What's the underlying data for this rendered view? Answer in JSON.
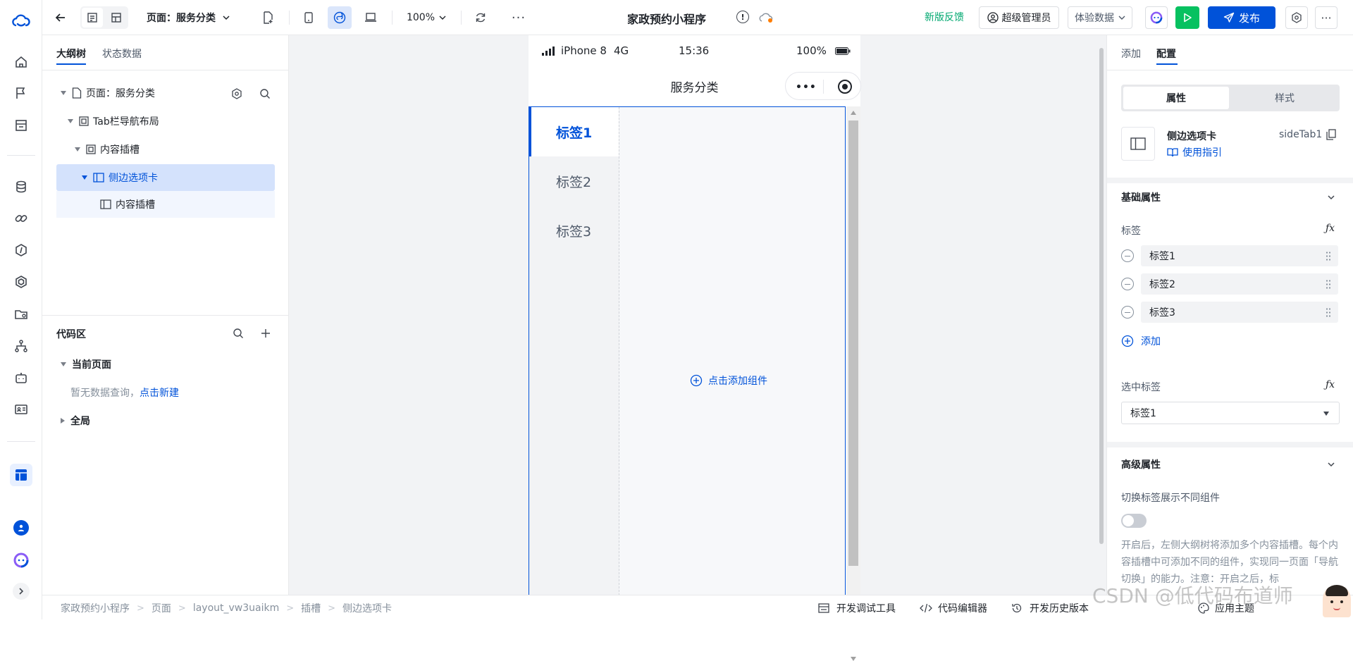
{
  "topbar": {
    "page_selector": "页面：服务分类",
    "zoom": "100%",
    "app_title": "家政预约小程序",
    "feedback": "新版反馈",
    "admin": "超级管理员",
    "data_env": "体验数据",
    "publish": "发布"
  },
  "left": {
    "tabs": [
      "大纲树",
      "状态数据"
    ],
    "tree": [
      {
        "label": "页面：服务分类"
      },
      {
        "label": "Tab栏导航布局"
      },
      {
        "label": "内容插槽"
      },
      {
        "label": "侧边选项卡"
      },
      {
        "label": "内容插槽"
      }
    ],
    "code_title": "代码区",
    "current_page": "当前页面",
    "empty_text": "暂无数据查询，",
    "new_link": "点击新建",
    "global": "全局"
  },
  "phone": {
    "carrier": "iPhone 8",
    "network": "4G",
    "time": "15:36",
    "battery": "100%",
    "page_title": "服务分类",
    "tabs": [
      "标签1",
      "标签2",
      "标签3"
    ],
    "add_component": "点击添加组件"
  },
  "right": {
    "tabs": [
      "添加",
      "配置"
    ],
    "segment": [
      "属性",
      "样式"
    ],
    "component_name": "侧边选项卡",
    "component_id": "sideTab1",
    "guide": "使用指引",
    "basic_title": "基础属性",
    "tags_label": "标签",
    "tag_items": [
      "标签1",
      "标签2",
      "标签3"
    ],
    "add_label": "添加",
    "selected_label": "选中标签",
    "selected_value": "标签1",
    "advanced_title": "高级属性",
    "switch_label": "切换标签展示不同组件",
    "description": "开启后，左侧大纲树将添加多个内容插槽。每个内容插槽中可添加不同的组件，实现同一页面「导航切换」的能力。注意：开启之后，标"
  },
  "bottom": {
    "breadcrumb": [
      "家政预约小程序",
      "页面",
      "layout_vw3uaikm",
      "插槽",
      "侧边选项卡"
    ],
    "dev_tools": "开发调试工具",
    "code_editor": "代码编辑器",
    "history": "开发历史版本",
    "theme": "应用主题"
  },
  "watermark": "CSDN @低代码布道师",
  "colors": {
    "accent": "#0052d9",
    "green": "#07c160",
    "feedback_green": "#00a870"
  }
}
